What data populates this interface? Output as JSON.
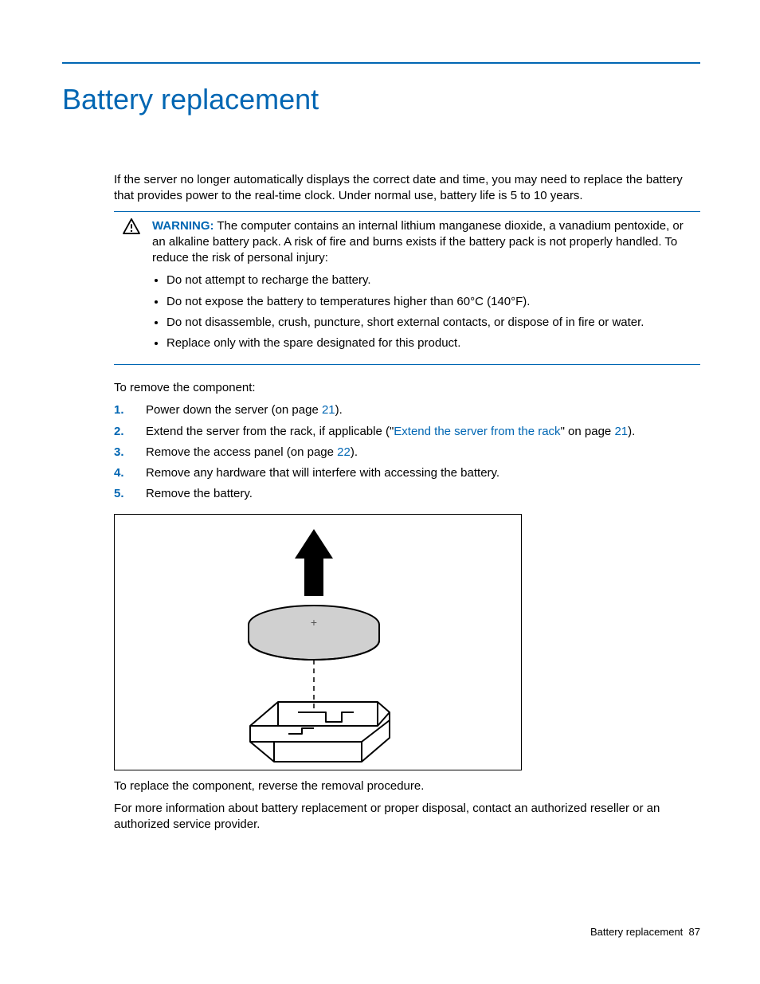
{
  "title": "Battery replacement",
  "intro": "If the server no longer automatically displays the correct date and time, you may need to replace the battery that provides power to the real-time clock. Under normal use, battery life is 5 to 10 years.",
  "warning": {
    "label": "WARNING:",
    "text": " The computer contains an internal lithium manganese dioxide, a vanadium pentoxide, or an alkaline battery pack. A risk of fire and burns exists if the battery pack is not properly handled. To reduce the risk of personal injury:",
    "bullets": [
      "Do not attempt to recharge the battery.",
      "Do not expose the battery to temperatures higher than 60°C (140°F).",
      "Do not disassemble, crush, puncture, short external contacts, or dispose of in fire or water.",
      "Replace only with the spare designated for this product."
    ]
  },
  "remove_label": "To remove the component:",
  "steps": {
    "s1_a": "Power down the server (on page ",
    "s1_link": "21",
    "s1_b": ").",
    "s2_a": "Extend the server from the rack, if applicable (\"",
    "s2_link1": "Extend the server from the rack",
    "s2_b": "\" on page ",
    "s2_link2": "21",
    "s2_c": ").",
    "s3_a": "Remove the access panel (on page ",
    "s3_link": "22",
    "s3_b": ").",
    "s4": "Remove any hardware that will interfere with accessing the battery.",
    "s5": "Remove the battery."
  },
  "closing1": "To replace the component, reverse the removal procedure.",
  "closing2": "For more information about battery replacement or proper disposal, contact an authorized reseller or an authorized service provider.",
  "footer_label": "Battery replacement",
  "footer_page": "87"
}
